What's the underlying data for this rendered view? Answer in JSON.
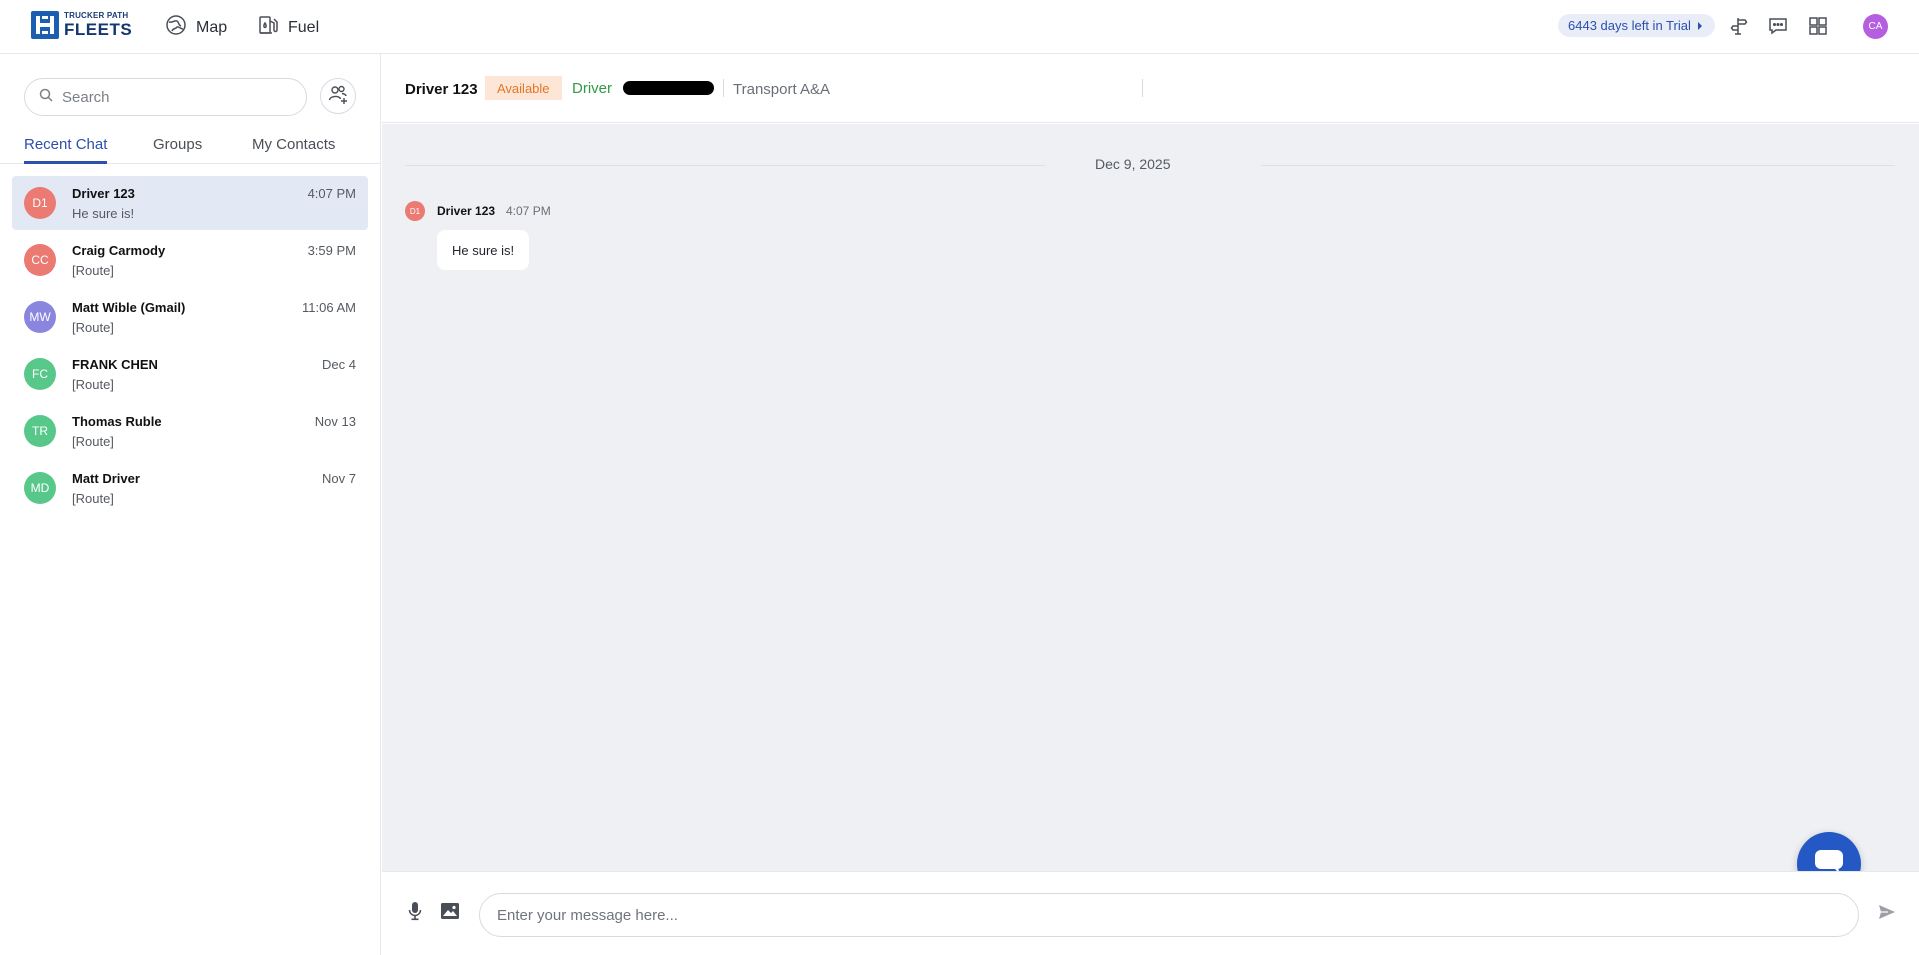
{
  "topbar": {
    "logo_small": "TRUCKER PATH",
    "logo_big": "FLEETS",
    "nav": [
      {
        "label": "Map",
        "icon": "map-icon"
      },
      {
        "label": "Fuel",
        "icon": "fuel-icon"
      }
    ],
    "trial_label": "6443 days left in Trial",
    "avatar_initials": "CA",
    "avatar_color": "#b65ee0"
  },
  "sidebar": {
    "search_placeholder": "Search",
    "tabs": [
      {
        "label": "Recent Chat",
        "active": true
      },
      {
        "label": "Groups",
        "active": false
      },
      {
        "label": "My Contacts",
        "active": false
      }
    ],
    "chats": [
      {
        "initials": "D1",
        "name": "Driver 123",
        "preview": "He sure is!",
        "time": "4:07 PM",
        "color": "#ea7a72",
        "active": true
      },
      {
        "initials": "CC",
        "name": "Craig Carmody",
        "preview": "[Route]",
        "time": "3:59 PM",
        "color": "#ea7a72",
        "active": false
      },
      {
        "initials": "MW",
        "name": "Matt Wible (Gmail)",
        "preview": "[Route]",
        "time": "11:06 AM",
        "color": "#8a86de",
        "active": false
      },
      {
        "initials": "FC",
        "name": "FRANK CHEN",
        "preview": "[Route]",
        "time": "Dec 4",
        "color": "#58c88a",
        "active": false
      },
      {
        "initials": "TR",
        "name": "Thomas Ruble",
        "preview": "[Route]",
        "time": "Nov 13",
        "color": "#58c88a",
        "active": false
      },
      {
        "initials": "MD",
        "name": "Matt Driver",
        "preview": "[Route]",
        "time": "Nov 7",
        "color": "#58c88a",
        "active": false
      }
    ]
  },
  "chat_header": {
    "name": "Driver 123",
    "status": "Available",
    "role": "Driver",
    "company": "Transport A&A"
  },
  "messages": {
    "date": "Dec 9, 2025",
    "items": [
      {
        "initials": "D1",
        "sender": "Driver 123",
        "time": "4:07 PM",
        "text": "He sure is!"
      }
    ]
  },
  "composer": {
    "placeholder": "Enter your message here..."
  },
  "colors": {
    "accent": "#2d4fae",
    "fab": "#2458c4",
    "status_bg": "#fde6d6",
    "status_text": "#e2772a",
    "role_text": "#2f9a4a"
  }
}
